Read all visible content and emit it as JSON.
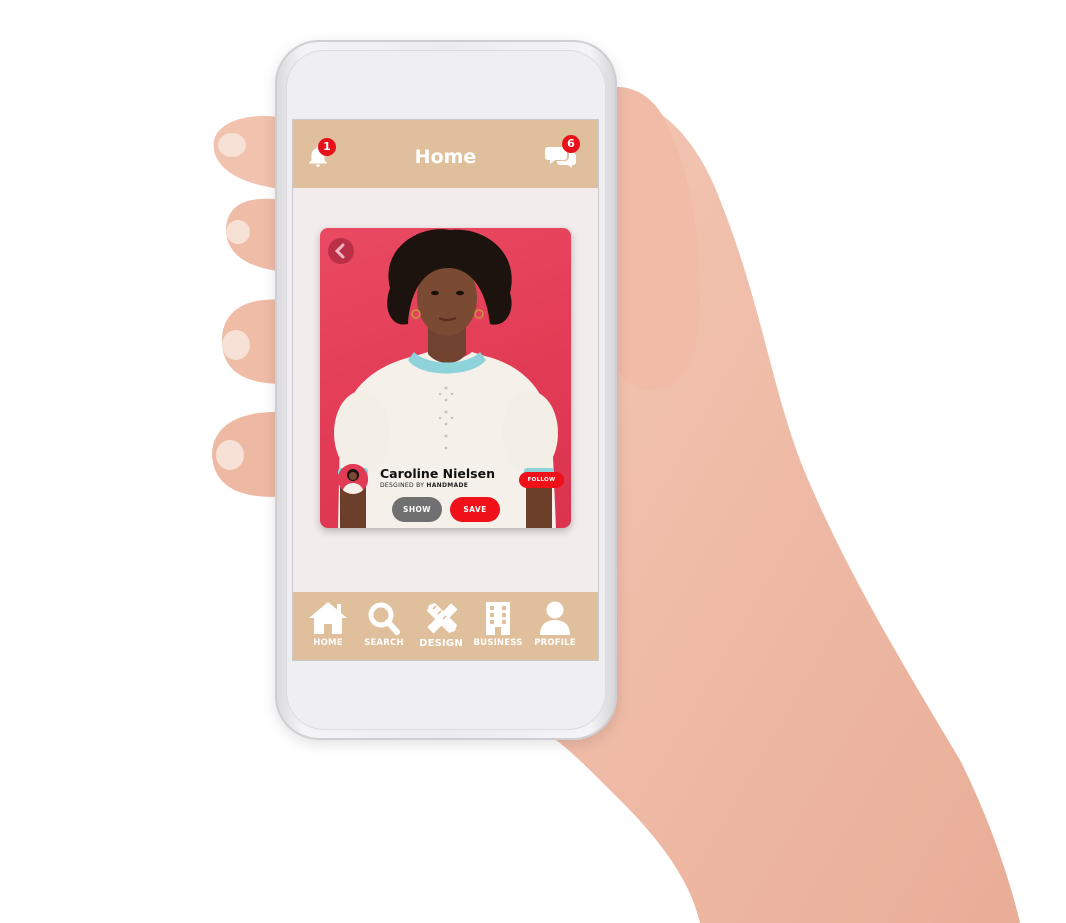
{
  "header": {
    "title": "Home",
    "notifications_badge": "1",
    "messages_badge": "6"
  },
  "card": {
    "designer_name": "Caroline Nielsen",
    "designed_by_prefix": "DESGINED BY",
    "designed_by_brand": "HANDMADE",
    "follow_label": "FOLLOW",
    "show_label": "SHOW",
    "save_label": "SAVE"
  },
  "nav": {
    "items": [
      {
        "label": "HOME",
        "icon": "home-icon"
      },
      {
        "label": "SEARCH",
        "icon": "search-icon"
      },
      {
        "label": "DESIGN",
        "icon": "design-pencil-ruler-icon"
      },
      {
        "label": "BUSINESS",
        "icon": "building-icon"
      },
      {
        "label": "PROFILE",
        "icon": "user-icon"
      }
    ]
  },
  "colors": {
    "header_bg": "#e0bf9c",
    "accent_red": "#f0101a",
    "screen_bg": "#f3ecec",
    "card_bg": "#e23b55",
    "show_button": "#707070"
  }
}
